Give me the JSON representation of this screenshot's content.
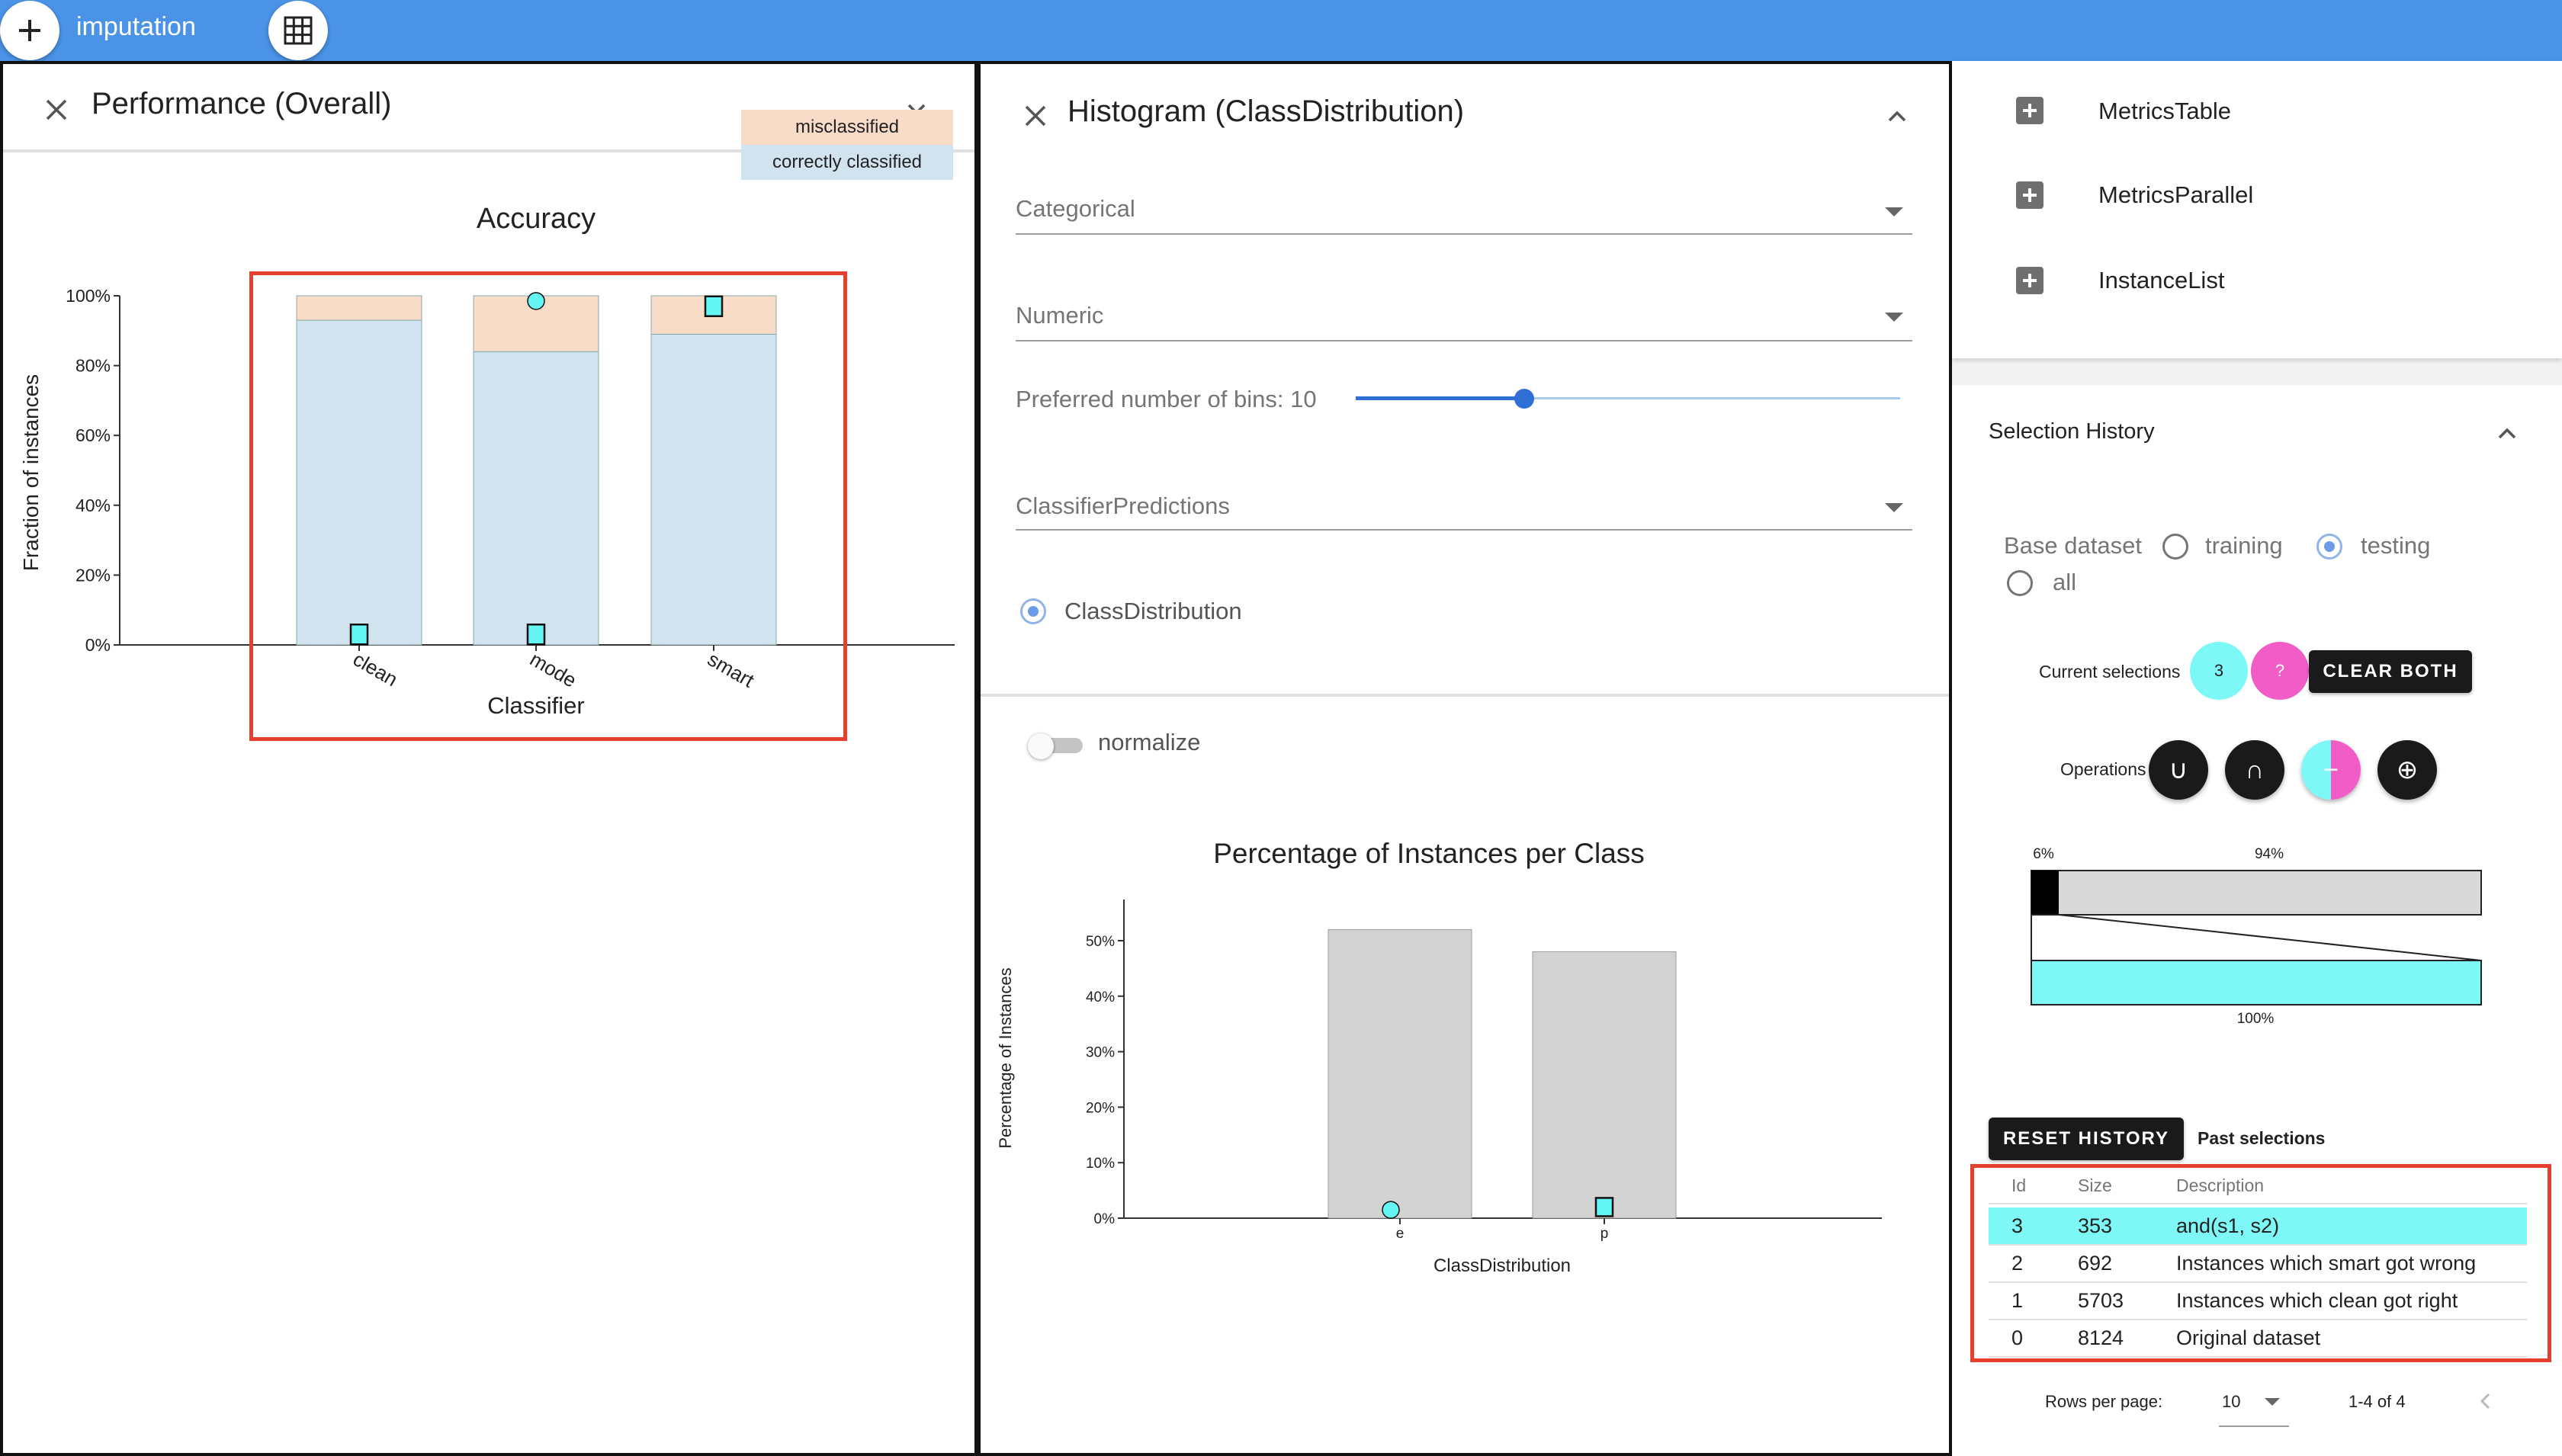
{
  "app": {
    "title": "imputation",
    "add_icon": "plus-icon",
    "grid_icon": "grid-icon",
    "accent": "#4a93e6"
  },
  "performance_panel": {
    "title": "Performance (Overall)",
    "chart_title": "Accuracy",
    "legend_misclassified": "misclassified",
    "legend_correct": "correctly classified",
    "xlabel": "Classifier",
    "ylabel": "Fraction of instances"
  },
  "histogram_panel": {
    "title": "Histogram (ClassDistribution)",
    "categorical_label": "Categorical",
    "numeric_label": "Numeric",
    "bins_label": "Preferred number of bins: 10",
    "bins_value": 10,
    "bins_slider_fraction": 0.31,
    "predictions_label": "ClassifierPredictions",
    "class_radio_label": "ClassDistribution",
    "normalize_label": "normalize",
    "chart_title": "Percentage of Instances per Class",
    "xlabel": "ClassDistribution",
    "ylabel": "Percentage of Instances"
  },
  "widgets": {
    "items": [
      {
        "label": "MetricsTable"
      },
      {
        "label": "MetricsParallel"
      },
      {
        "label": "InstanceList"
      }
    ]
  },
  "selection_history": {
    "title": "Selection History",
    "base_dataset_label": "Base dataset",
    "opt_training": "training",
    "opt_testing": "testing",
    "opt_all": "all",
    "selected_option": "testing",
    "current_label": "Current selections",
    "sel1_label": "3",
    "sel2_label": "?",
    "clear_label": "CLEAR BOTH",
    "operations_label": "Operations",
    "ops": [
      "∪",
      "∩",
      "−",
      "⊕"
    ],
    "venn_left_pct": "6%",
    "venn_right_pct": "94%",
    "venn_bottom_pct": "100%",
    "reset_label": "RESET HISTORY",
    "past_label": "Past selections",
    "table_headers": {
      "id": "Id",
      "size": "Size",
      "desc": "Description"
    },
    "rows": [
      {
        "id": "3",
        "size": "353",
        "desc": "and(s1, s2)"
      },
      {
        "id": "2",
        "size": "692",
        "desc": "Instances which smart got wrong"
      },
      {
        "id": "1",
        "size": "5703",
        "desc": "Instances which clean got right"
      },
      {
        "id": "0",
        "size": "8124",
        "desc": "Original dataset"
      }
    ],
    "rows_per_page_label": "Rows per page:",
    "rows_per_page_value": "10",
    "pagination_label": "1-4 of 4",
    "highlight_color": "#7ef7f7"
  },
  "chart_data": [
    {
      "type": "bar",
      "title": "Accuracy",
      "xlabel": "Classifier",
      "ylabel": "Fraction of instances",
      "categories": [
        "clean",
        "mode",
        "smart"
      ],
      "series": [
        {
          "name": "correctly classified",
          "values": [
            0.93,
            0.84,
            0.89
          ]
        },
        {
          "name": "misclassified",
          "values": [
            0.07,
            0.16,
            0.11
          ]
        }
      ],
      "yticks": [
        "0%",
        "20%",
        "40%",
        "60%",
        "80%",
        "100%"
      ],
      "ylim": [
        0,
        1
      ],
      "selection_markers": [
        {
          "category": "clean",
          "shape": "square",
          "value": 0.03
        },
        {
          "category": "mode",
          "shape": "square",
          "value": 0.03
        },
        {
          "category": "mode",
          "shape": "circle",
          "value": 0.985
        },
        {
          "category": "smart",
          "shape": "square",
          "value": 0.97
        }
      ],
      "colors": {
        "correct": "#d2e3f0",
        "misclassified": "#f8dcc8",
        "marker": "#64f5f5"
      }
    },
    {
      "type": "bar",
      "title": "Percentage of Instances per Class",
      "xlabel": "ClassDistribution",
      "ylabel": "Percentage of Instances",
      "categories": [
        "e",
        "p"
      ],
      "values": [
        52,
        48
      ],
      "yticks": [
        "0%",
        "10%",
        "20%",
        "30%",
        "40%",
        "50%"
      ],
      "ylim": [
        0,
        52
      ],
      "selection_markers": [
        {
          "category": "e",
          "shape": "circle",
          "value": 1.5
        },
        {
          "category": "p",
          "shape": "square",
          "value": 2
        }
      ],
      "colors": {
        "bar": "#d3d3d3",
        "marker": "#64f5f5"
      }
    }
  ]
}
